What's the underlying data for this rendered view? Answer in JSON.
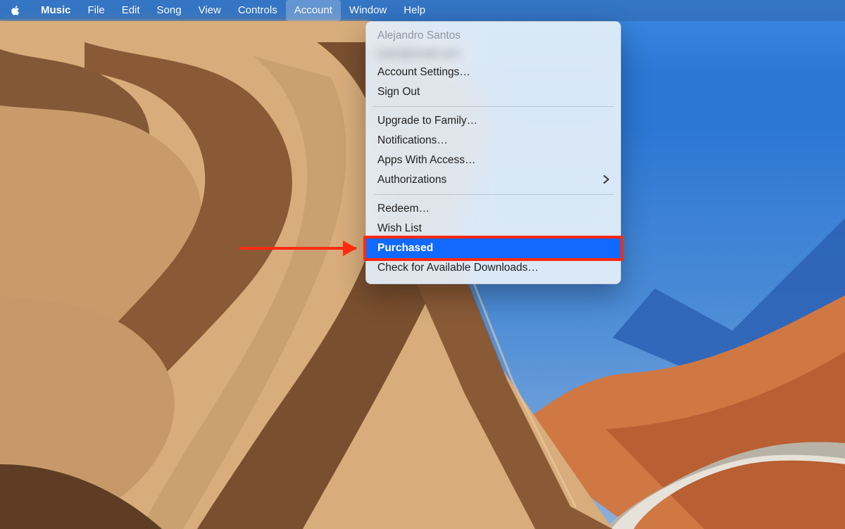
{
  "menubar": {
    "app": "Music",
    "items": {
      "file": "File",
      "edit": "Edit",
      "song": "Song",
      "view": "View",
      "controls": "Controls",
      "account": "Account",
      "window": "Window",
      "help": "Help"
    },
    "open": "account"
  },
  "menu": {
    "user_name": "Alejandro Santos",
    "user_email_redacted": "user@email.com",
    "account_settings": "Account Settings…",
    "sign_out": "Sign Out",
    "upgrade_family": "Upgrade to Family…",
    "notifications": "Notifications…",
    "apps_with_access": "Apps With Access…",
    "authorizations": "Authorizations",
    "redeem": "Redeem…",
    "wish_list": "Wish List",
    "purchased": "Purchased",
    "check_downloads": "Check for Available Downloads…"
  },
  "annotation": {
    "target": "purchased"
  }
}
